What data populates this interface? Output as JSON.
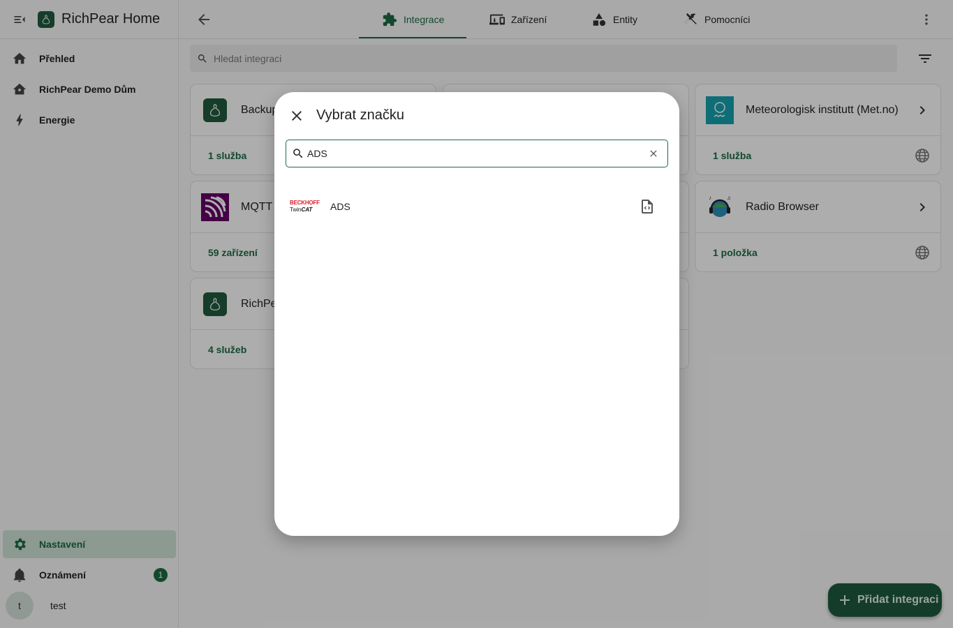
{
  "app": {
    "title": "RichPear Home"
  },
  "sidebar": {
    "items": [
      {
        "label": "Přehled",
        "icon": "home-icon"
      },
      {
        "label": "RichPear Demo Dům",
        "icon": "home-roof-icon"
      },
      {
        "label": "Energie",
        "icon": "lightning-icon"
      }
    ],
    "bottom": [
      {
        "label": "Nastavení",
        "icon": "gear-icon",
        "active": true
      },
      {
        "label": "Oznámení",
        "icon": "bell-icon",
        "badge": "1"
      }
    ],
    "user": {
      "initial": "t",
      "name": "test"
    }
  },
  "tabs": [
    {
      "label": "Integrace",
      "icon": "puzzle-icon",
      "active": true
    },
    {
      "label": "Zařízení",
      "icon": "devices-icon"
    },
    {
      "label": "Entity",
      "icon": "shapes-icon"
    },
    {
      "label": "Pomocníci",
      "icon": "tools-icon"
    }
  ],
  "search": {
    "placeholder": "Hledat integraci"
  },
  "cards": [
    {
      "name": "Backup",
      "footer": "1 služba"
    },
    {
      "name": "Meteorologisk institutt (Met.no)",
      "footer": "1 služba"
    },
    {
      "name": "MQTT",
      "footer": "59 zařízení"
    },
    {
      "name": "Radio Browser",
      "footer": "1 položka"
    },
    {
      "name": "RichPear",
      "footer": "4 služeb"
    }
  ],
  "fab": {
    "label": "Přidat integraci"
  },
  "dialog": {
    "title": "Vybrat značku",
    "search_value": "ADS",
    "results": [
      {
        "name": "ADS",
        "logo_top": "BECKHOFF",
        "logo_bottom_1": "Twin",
        "logo_bottom_2": "CAT"
      }
    ]
  },
  "colors": {
    "primary": "#1d6b46",
    "fab": "#1d5b3e",
    "active_bg": "#cfe3d8"
  }
}
